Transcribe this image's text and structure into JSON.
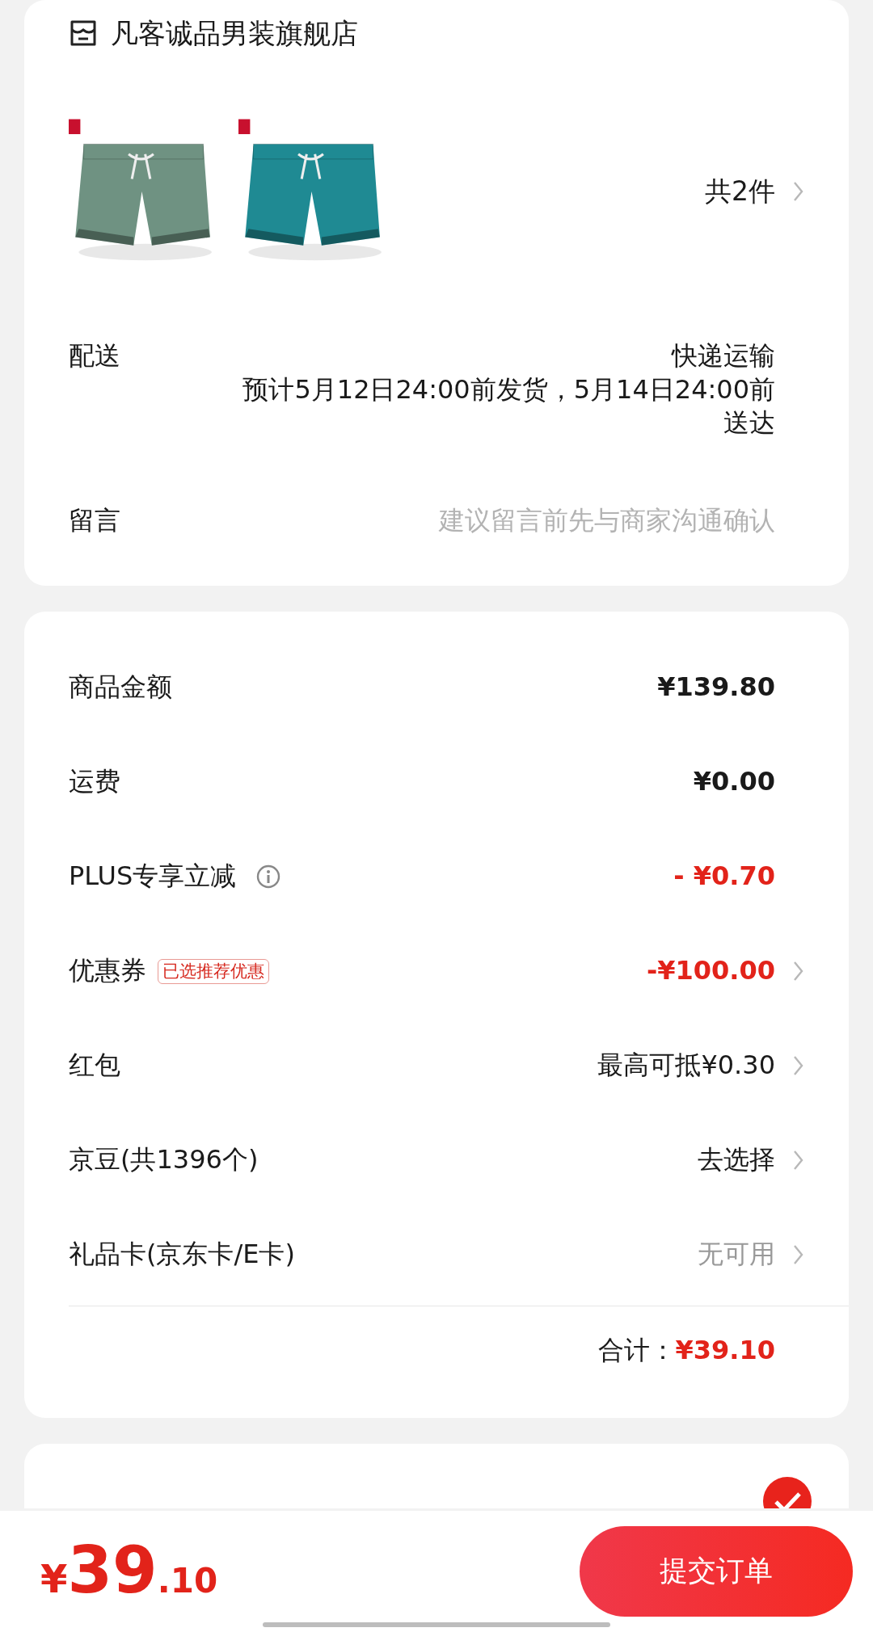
{
  "store": {
    "name": "凡客诚品男装旗舰店"
  },
  "item_count": "共2件",
  "delivery": {
    "label": "配送",
    "method": "快递运输",
    "estimate": "预计5月12日24:00前发货，5月14日24:00前送达"
  },
  "message": {
    "label": "留言",
    "placeholder": "建议留言前先与商家沟通确认"
  },
  "costs": [
    {
      "label": "商品金额",
      "value": "¥139.80",
      "kind": "amount",
      "chevron": false
    },
    {
      "label": "运费",
      "value": "¥0.00",
      "kind": "amount",
      "chevron": false
    },
    {
      "label": "PLUS专享立减",
      "info_icon": true,
      "value": "- ¥0.70",
      "kind": "discount",
      "chevron": false
    },
    {
      "label": "优惠券",
      "tag": "已选推荐优惠",
      "value": "-¥100.00",
      "kind": "discount",
      "chevron": true
    },
    {
      "label": "红包",
      "value": "最高可抵¥0.30",
      "kind": "option",
      "chevron": true
    },
    {
      "label": "京豆(共1396个)",
      "value": "去选择",
      "kind": "option",
      "chevron": true
    },
    {
      "label": "礼品卡(京东卡/E卡)",
      "value": "无可用",
      "kind": "unavailable",
      "chevron": true
    }
  ],
  "total": {
    "label": "合计：",
    "value": "¥39.10"
  },
  "payment": {
    "selected": true
  },
  "bottom_bar": {
    "currency": "¥",
    "integer": "39",
    "decimal": ".10",
    "submit": "提交订单"
  }
}
